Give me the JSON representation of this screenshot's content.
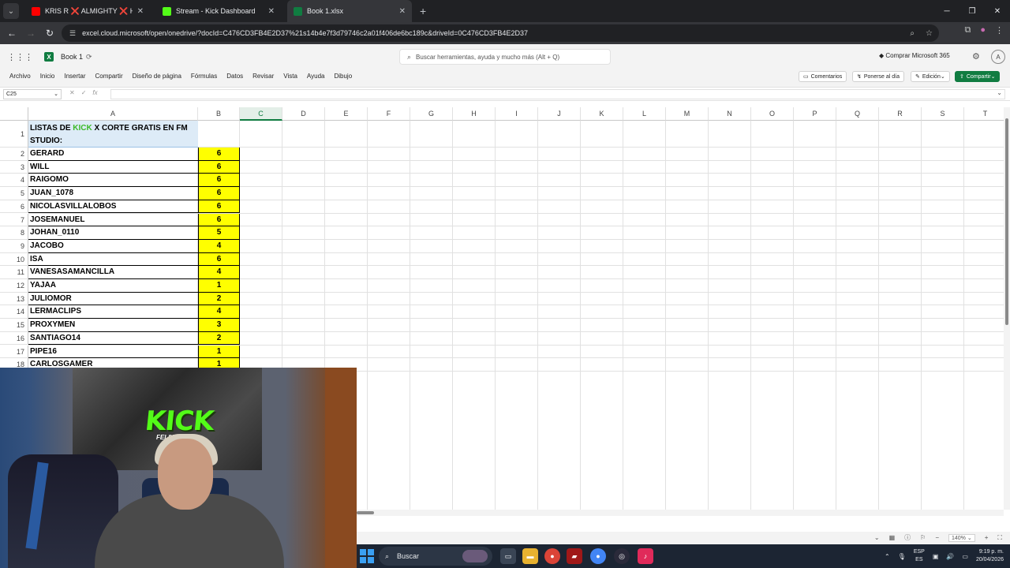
{
  "browser": {
    "tabs": [
      {
        "label": "KRIS R ❌ ALMIGHTY ❌ HADE",
        "color": "#ff0000",
        "active": false
      },
      {
        "label": "Stream - Kick Dashboard",
        "color": "#53fc18",
        "active": false
      },
      {
        "label": "Book 1.xlsx",
        "color": "#107c41",
        "active": true
      }
    ],
    "new_tab": "+",
    "url": "excel.cloud.microsoft/open/onedrive/?docId=C476CD3FB4E2D37%21s14b4e7f3d79746c2a01f406de6bc189c&driveId=0C476CD3FB4E2D37"
  },
  "excel": {
    "doc_title": "Book 1",
    "search_placeholder": "Buscar herramientas, ayuda y mucho más (Alt + Q)",
    "buy_label": "Comprar Microsoft 365",
    "avatar": "A",
    "ribbon_tabs": [
      "Archivo",
      "Inicio",
      "Insertar",
      "Compartir",
      "Diseño de página",
      "Fórmulas",
      "Datos",
      "Revisar",
      "Vista",
      "Ayuda",
      "Dibujo"
    ],
    "comments_label": "Comentarios",
    "catchup_label": "Ponerse al día",
    "edit_label": "Edición",
    "share_label": "Compartir",
    "name_box": "C25",
    "fx_label": "fx",
    "selected_column": "C",
    "columns": [
      "A",
      "B",
      "C",
      "D",
      "E",
      "F",
      "G",
      "H",
      "I",
      "J",
      "K",
      "L",
      "M",
      "N",
      "O",
      "P",
      "Q",
      "R",
      "S",
      "T"
    ],
    "title_cell": {
      "before": "LISTAS DE ",
      "kick": "KICK",
      "after": " X CORTE GRATIS EN FM STUDIO:"
    },
    "rows": [
      {
        "n": "1"
      },
      {
        "n": "2",
        "name": "GERARD",
        "value": "6"
      },
      {
        "n": "3",
        "name": "WILL",
        "value": "6"
      },
      {
        "n": "4",
        "name": "RAIGOMO",
        "value": "6"
      },
      {
        "n": "5",
        "name": "JUAN_1078",
        "value": "6"
      },
      {
        "n": "6",
        "name": "NICOLASVILLALOBOS",
        "value": "6"
      },
      {
        "n": "7",
        "name": "JOSEMANUEL",
        "value": "6"
      },
      {
        "n": "8",
        "name": "JOHAN_0110",
        "value": "5"
      },
      {
        "n": "9",
        "name": "JACOBO",
        "value": "4"
      },
      {
        "n": "10",
        "name": "ISA",
        "value": "6"
      },
      {
        "n": "11",
        "name": "VANESASAMANCILLA",
        "value": "4"
      },
      {
        "n": "12",
        "name": "YAJAA",
        "value": "1"
      },
      {
        "n": "13",
        "name": "JULIOMOR",
        "value": "2"
      },
      {
        "n": "14",
        "name": "LERMACLIPS",
        "value": "4"
      },
      {
        "n": "15",
        "name": "PROXYMEN",
        "value": "3"
      },
      {
        "n": "16",
        "name": "SANTIAGO14",
        "value": "2"
      },
      {
        "n": "17",
        "name": "PIPE16",
        "value": "1"
      },
      {
        "n": "18",
        "name": "CARLOSGAMER",
        "value": "1"
      }
    ],
    "zoom": "140%"
  },
  "taskbar": {
    "search_label": "Buscar",
    "lang_top": "ESP",
    "lang_bottom": "ES",
    "time": "9:19 p. m.",
    "date": "20/04/2026"
  },
  "webcam": {
    "logo_text": "KICK",
    "logo_sub": "FELIWORLD"
  }
}
